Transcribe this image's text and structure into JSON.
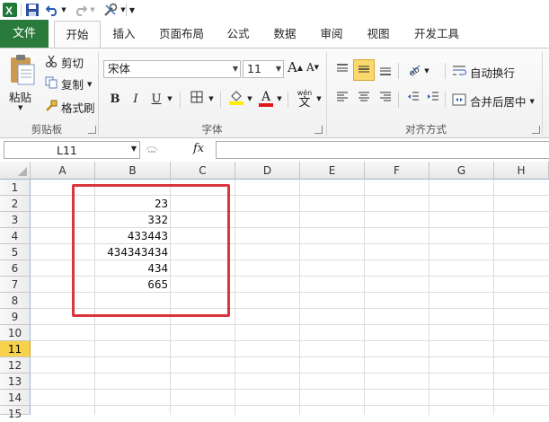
{
  "quick_access": {
    "icons": [
      "excel-logo-icon",
      "save-icon",
      "undo-icon",
      "redo-icon",
      "tools-icon",
      "customize-icon"
    ]
  },
  "tabs": [
    {
      "label": "文件"
    },
    {
      "label": "开始"
    },
    {
      "label": "插入"
    },
    {
      "label": "页面布局"
    },
    {
      "label": "公式"
    },
    {
      "label": "数据"
    },
    {
      "label": "审阅"
    },
    {
      "label": "视图"
    },
    {
      "label": "开发工具"
    }
  ],
  "clipboard": {
    "paste_label": "粘贴",
    "cut_label": "剪切",
    "copy_label": "复制",
    "format_painter_label": "格式刷",
    "group_label": "剪贴板"
  },
  "font": {
    "font_name": "宋体",
    "font_size": "11",
    "bold": "B",
    "italic": "I",
    "underline": "U",
    "color_letter": "A",
    "phonetic": "wén",
    "group_label": "字体",
    "grow_label": "A",
    "shrink_label": "A",
    "fill_color": "#ffef00",
    "font_color": "#e0171b"
  },
  "alignment": {
    "wrap_label": "自动换行",
    "merge_label": "合并后居中",
    "group_label": "对齐方式"
  },
  "formula_bar": {
    "name_box": "L11",
    "fx_label": "fx",
    "formula": ""
  },
  "grid": {
    "columns": [
      "A",
      "B",
      "C",
      "D",
      "E",
      "F",
      "G",
      "H"
    ],
    "rows": [
      "1",
      "2",
      "3",
      "4",
      "5",
      "6",
      "7",
      "8",
      "9",
      "10",
      "11",
      "12",
      "13",
      "14",
      "15"
    ],
    "active_row": "11",
    "column_b_values": [
      "23",
      "332",
      "433443",
      "434343434",
      "434",
      "665"
    ]
  },
  "colors": {
    "file_tab": "#2a7a3b",
    "highlight_border": "#d9363e",
    "active_row_header": "#f7d34b"
  }
}
